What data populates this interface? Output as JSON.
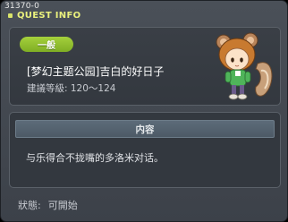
{
  "window": {
    "quest_id": "31370-0",
    "title": "QUEST INFO"
  },
  "info": {
    "badge": "一般",
    "quest_name": "[梦幻主题公园]吉白的好日子",
    "level_req": "建議等級: 120～124",
    "npc_icon": "squirrel-girl-npc-icon"
  },
  "content": {
    "header": "内容",
    "text": "与乐得合不拢嘴的多洛米对话。"
  },
  "status": {
    "label": "狀態:",
    "value": "可開始"
  },
  "colors": {
    "title_accent": "#e9f07d",
    "badge_green": "#8fbd2c",
    "panel_bg": "#33383f",
    "header_bg": "#55636f"
  }
}
